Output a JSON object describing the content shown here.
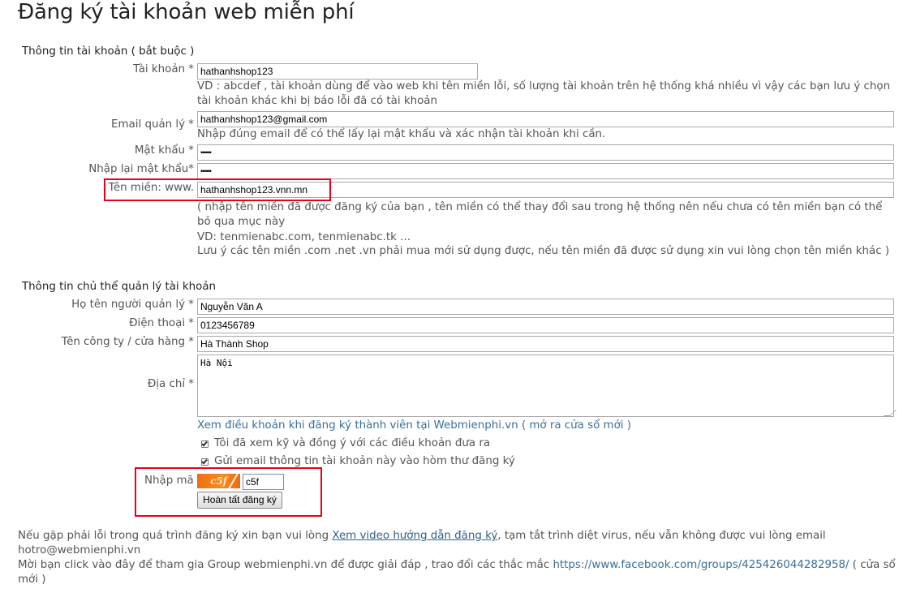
{
  "page": {
    "title": "Đăng ký tài khoản web miễn phí"
  },
  "account_section": {
    "heading": "Thông tin tài khoản ( bắt buộc )",
    "username": {
      "label": "Tài khoản *",
      "value": "hathanhshop123",
      "hint": "VD : abcdef , tài khoản dùng để vào web khi tên miền lỗi, số lượng tài khoản trên hệ thống khá nhiều vì vậy các bạn lưu ý chọn tài khoản khác khi bị báo lỗi đã có tài khoản"
    },
    "email": {
      "label": "Email quản lý *",
      "value": "hathanhshop123@gmail.com",
      "hint": "Nhập đúng email để có thể lấy lại mật khẩu và xác nhận tài khoản khi cần."
    },
    "password": {
      "label": "Mật khẩu *",
      "value": "••••••"
    },
    "password_confirm": {
      "label": "Nhập lại mật khẩu*",
      "value": "••••••"
    },
    "domain": {
      "label": "Tên miền: www.",
      "value": "hathanhshop123.vnn.mn",
      "hint1": "( nhập tên miền đã được đăng ký của bạn , tên miền có thể thay đổi sau trong hệ thống nên nếu chưa có tên miền bạn có thể bỏ qua mục này",
      "hint2": "VD: tenmienabc.com, tenmienabc.tk ...",
      "hint3": "Lưu ý các tên miền .com .net .vn phải mua mới sử dụng được, nếu tên miền đã được sử dụng xin vui lòng chọn tên miền khác )"
    }
  },
  "owner_section": {
    "heading": "Thông tin chủ thể quản lý tài khoản",
    "fullname": {
      "label": "Họ tên người quản lý *",
      "value": "Nguyễn Văn A"
    },
    "phone": {
      "label": "Điện thoại *",
      "value": "0123456789"
    },
    "company": {
      "label": "Tên công ty / cửa hàng *",
      "value": "Hà Thành Shop"
    },
    "address": {
      "label": "Địa chỉ *",
      "value": "Hà Nội"
    },
    "terms_link": "Xem điều khoản khi đăng ký thành viên tại Webmienphi.vn ( mở ra cửa sổ mới )",
    "agree_label": "Tôi đã xem kỹ và đồng ý với các điều khoản đưa ra",
    "agree_checked": true,
    "send_email_label": "Gửi email thông tin tài khoản này vào hòm thư đăng ký",
    "send_email_checked": true,
    "captcha_label": "Nhập mã",
    "captcha_image_text": "c5f",
    "captcha_value": "c5f",
    "submit_label": "Hoàn tất đăng ký"
  },
  "footer": {
    "line1_prefix": "Nếu gặp phải lỗi trong quá trình đăng ký xin bạn vui lòng ",
    "line1_link": "Xem video hướng dẫn đăng ký",
    "line1_suffix": ", tạm tắt trình diệt virus, nếu vẫn không được vui lòng email hotro@webmienphi.vn",
    "line2_prefix": "Mời bạn click vào đây để tham gia Group webmienphi.vn để được giải đáp , trao đổi các thắc mắc ",
    "line2_link": "https://www.facebook.com/groups/425426044282958/",
    "line2_suffix": " ( cửa sổ mới )"
  },
  "colors": {
    "highlight_border": "#e8001c",
    "link": "#3a6e9a",
    "captcha_bg": "#ef6f11"
  }
}
